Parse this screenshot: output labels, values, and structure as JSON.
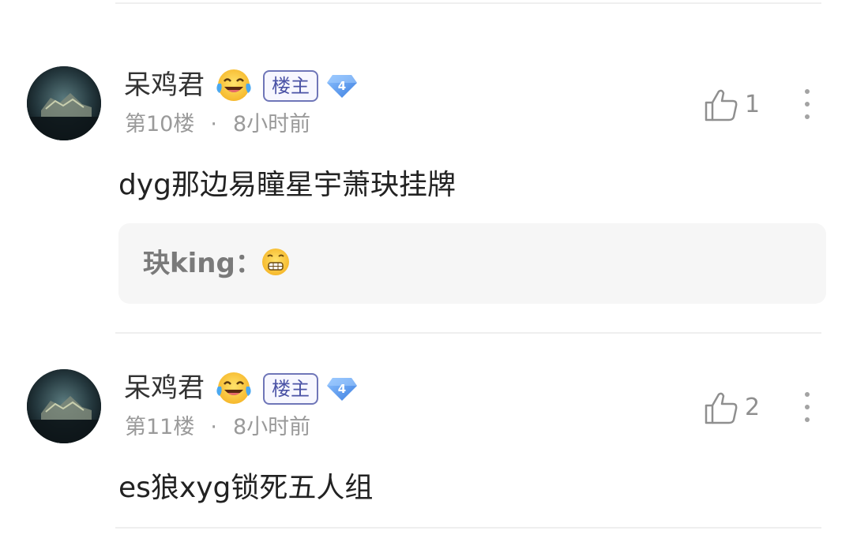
{
  "comments": [
    {
      "username": "呆鸡君",
      "user_emoji_icon": "laughing-crying-emoji-icon",
      "op_badge": "楼主",
      "level": "4",
      "floor": "第10楼",
      "separator": "·",
      "time": "8小时前",
      "likes": "1",
      "content": "dyg那边易瞳星宇萧玦挂牌",
      "reply": {
        "author": "玦king：",
        "emoji_icon": "grimacing-emoji-icon"
      }
    },
    {
      "username": "呆鸡君",
      "user_emoji_icon": "laughing-crying-emoji-icon",
      "op_badge": "楼主",
      "level": "4",
      "floor": "第11楼",
      "separator": "·",
      "time": "8小时前",
      "likes": "2",
      "content": "es狼xyg锁死五人组"
    }
  ],
  "colors": {
    "op_badge_border": "#6f76b8",
    "level_badge": "#5b9bef",
    "meta_text": "#9a9a9a"
  }
}
